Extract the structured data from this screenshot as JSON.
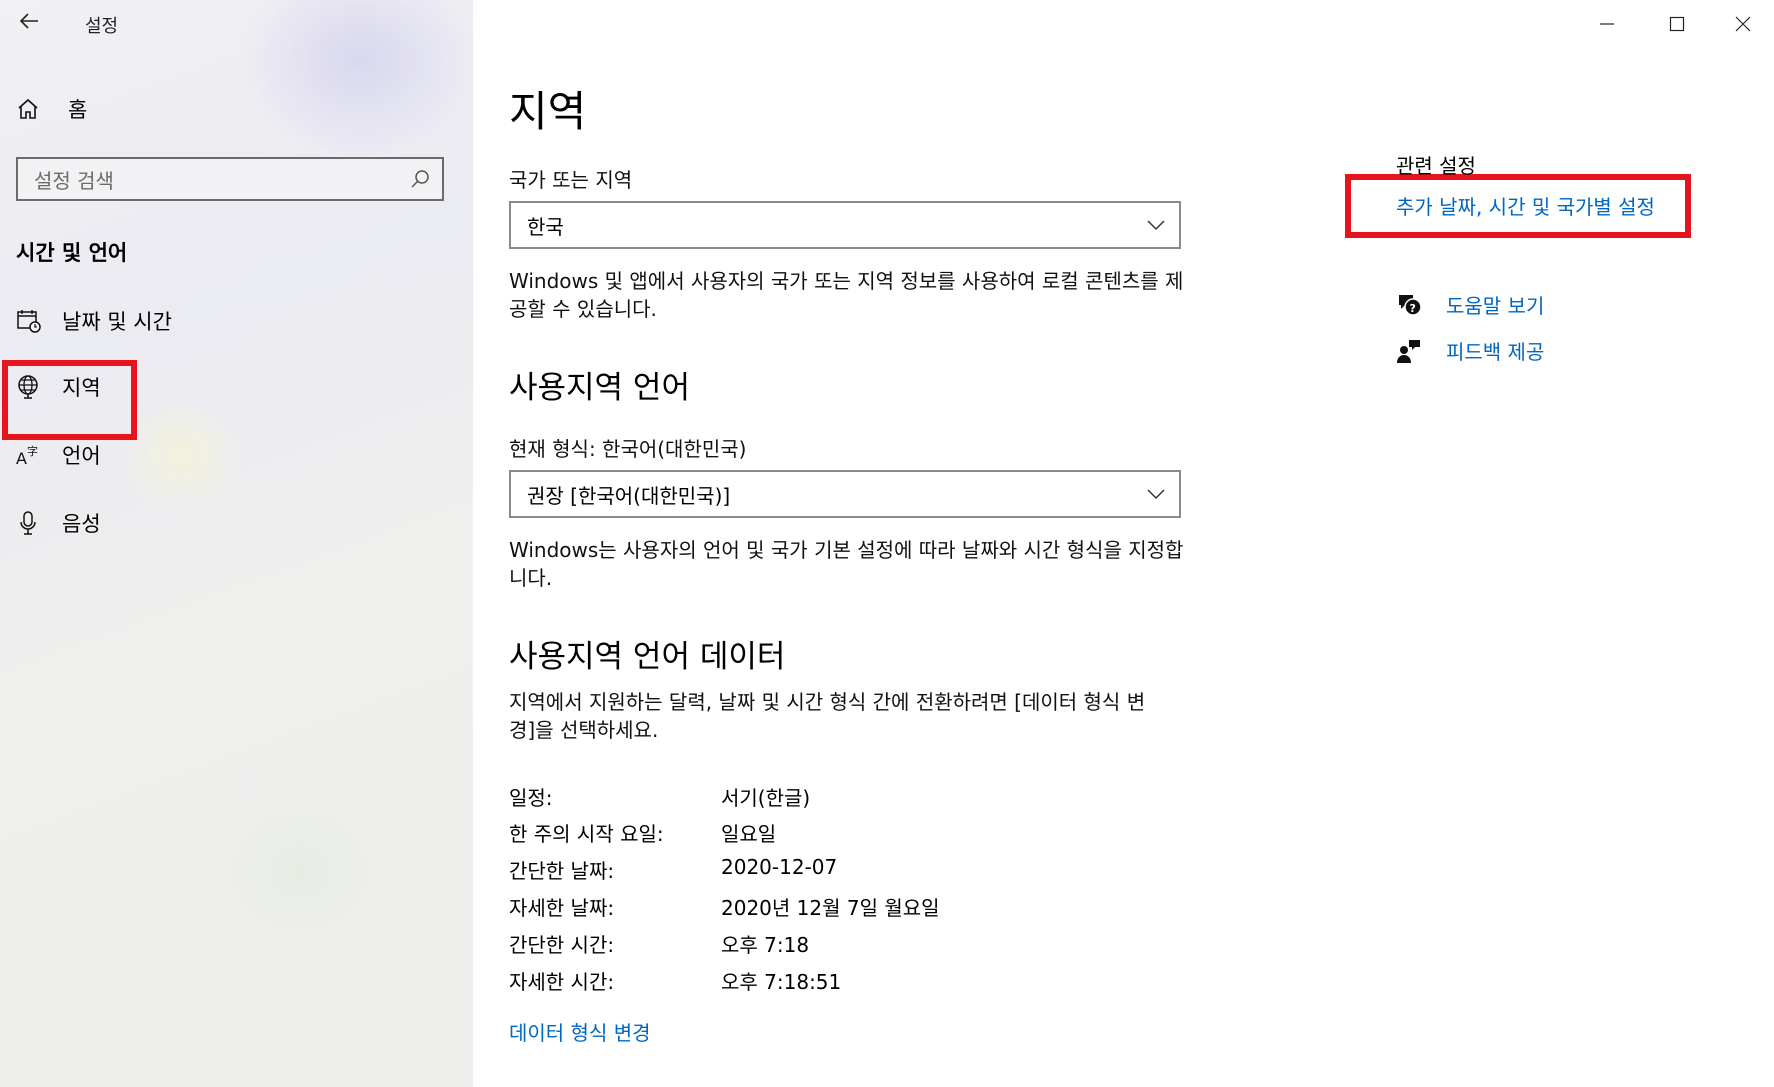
{
  "window": {
    "title": "설정"
  },
  "sidebar": {
    "home_label": "홈",
    "search_placeholder": "설정 검색",
    "section_title": "시간 및 언어",
    "items": [
      {
        "label": "날짜 및 시간",
        "icon": "calendar-clock-icon"
      },
      {
        "label": "지역",
        "icon": "globe-icon",
        "selected": true
      },
      {
        "label": "언어",
        "icon": "language-icon"
      },
      {
        "label": "음성",
        "icon": "microphone-icon"
      }
    ]
  },
  "main": {
    "title": "지역",
    "country": {
      "label": "국가 또는 지역",
      "value": "한국",
      "description": "Windows 및 앱에서 사용자의 국가 또는 지역 정보를 사용하여 로컬 콘텐츠를 제공할 수 있습니다."
    },
    "regional_format": {
      "heading": "사용지역 언어",
      "label": "현재 형식: 한국어(대한민국)",
      "value": "권장 [한국어(대한민국)]",
      "description": "Windows는 사용자의 언어 및 국가 기본 설정에 따라 날짜와 시간 형식을 지정합니다."
    },
    "format_data": {
      "heading": "사용지역 언어 데이터",
      "description": "지역에서 지원하는 달력, 날짜 및 시간 형식 간에 전환하려면 [데이터 형식 변경]을 선택하세요.",
      "rows": [
        {
          "key": "일정:",
          "value": "서기(한글)"
        },
        {
          "key": "한 주의 시작 요일:",
          "value": "일요일"
        },
        {
          "key": "간단한 날짜:",
          "value": "2020-12-07"
        },
        {
          "key": "자세한 날짜:",
          "value": "2020년 12월 7일 월요일"
        },
        {
          "key": "간단한 시간:",
          "value": "오후 7:18"
        },
        {
          "key": "자세한 시간:",
          "value": "오후 7:18:51"
        }
      ],
      "change_link": "데이터 형식 변경"
    }
  },
  "related": {
    "title": "관련 설정",
    "link": "추가 날짜, 시간 및 국가별 설정",
    "help": "도움말 보기",
    "feedback": "피드백 제공"
  },
  "colors": {
    "accent": "#0067c0",
    "highlight": "#e8141c"
  }
}
